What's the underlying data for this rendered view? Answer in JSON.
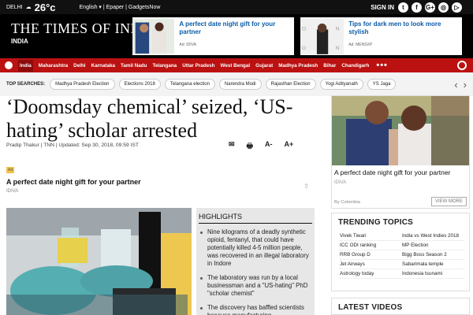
{
  "topbar": {
    "city": "DELHI",
    "temperature": "26°c",
    "links": "English ▾ | Epaper | GadgetsNow",
    "signin": "SIGN IN",
    "social": [
      "t",
      "f",
      "G+",
      "◎",
      "▷"
    ]
  },
  "masthead": {
    "logo": "THE TIMES OF INDIA",
    "edition": "INDIA"
  },
  "ads": [
    {
      "title": "A perfect date night gift for your partner",
      "source": "Ad: IDIVA"
    },
    {
      "title": "Tips for dark men to look more stylish",
      "source": "Ad: MENSXP"
    }
  ],
  "nav": {
    "items": [
      "India",
      "Maharashtra",
      "Delhi",
      "Karnataka",
      "Tamil Nadu",
      "Telangana",
      "Uttar Pradesh",
      "West Bengal",
      "Gujarat",
      "Madhya Pradesh",
      "Bihar",
      "Chandigarh"
    ],
    "more": "•••"
  },
  "top_searches": {
    "label": "TOP SEARCHES:",
    "items": [
      "Madhya Pradesh Election",
      "Elections 2018",
      "Telangana election",
      "Narendra Modi",
      "Rajasthan Election",
      "Yogi Adityanath",
      "YS Jaga"
    ]
  },
  "article": {
    "headline": "‘Doomsday chemical’ seized, ‘US-hating’ scholar arrested",
    "byline": "Pradip Thakur | TNN | Updated: Sep 30, 2018, 09:59 IST",
    "tools": [
      "✉",
      "🖶",
      "A-",
      "A+"
    ]
  },
  "sponsored": {
    "label": "Ad",
    "title": "A perfect date night gift for your partner",
    "source": "IDIVA"
  },
  "highlights": {
    "title": "HIGHLIGHTS",
    "items": [
      "Nine kilograms of a deadly synthetic opioid, fentanyl, that could have potentially killed 4-5 million people, was recovered in an illegal laboratory in Indore",
      "The laboratory was run by a local businessman and a \"US-hating\" PhD \"scholar chemist\"",
      "The discovery has baffled scientists because manufacturing"
    ]
  },
  "right_ad": {
    "title": "A perfect date night gift for your partner",
    "source": "IDIVA",
    "by": "By Colombia",
    "button": "VIEW MORE"
  },
  "trending": {
    "title": "TRENDING TOPICS",
    "left": [
      "Vivek Tiwari",
      "ICC ODI ranking",
      "RRB Group D",
      "Jet Airways",
      "Astrology today"
    ],
    "right": [
      "India vs West Indies 2018",
      "MP Election",
      "Bigg Boss Season 2",
      "Sabarimala temple",
      "Indonesia tsunami"
    ]
  },
  "videos": {
    "title": "LATEST VIDEOS"
  }
}
